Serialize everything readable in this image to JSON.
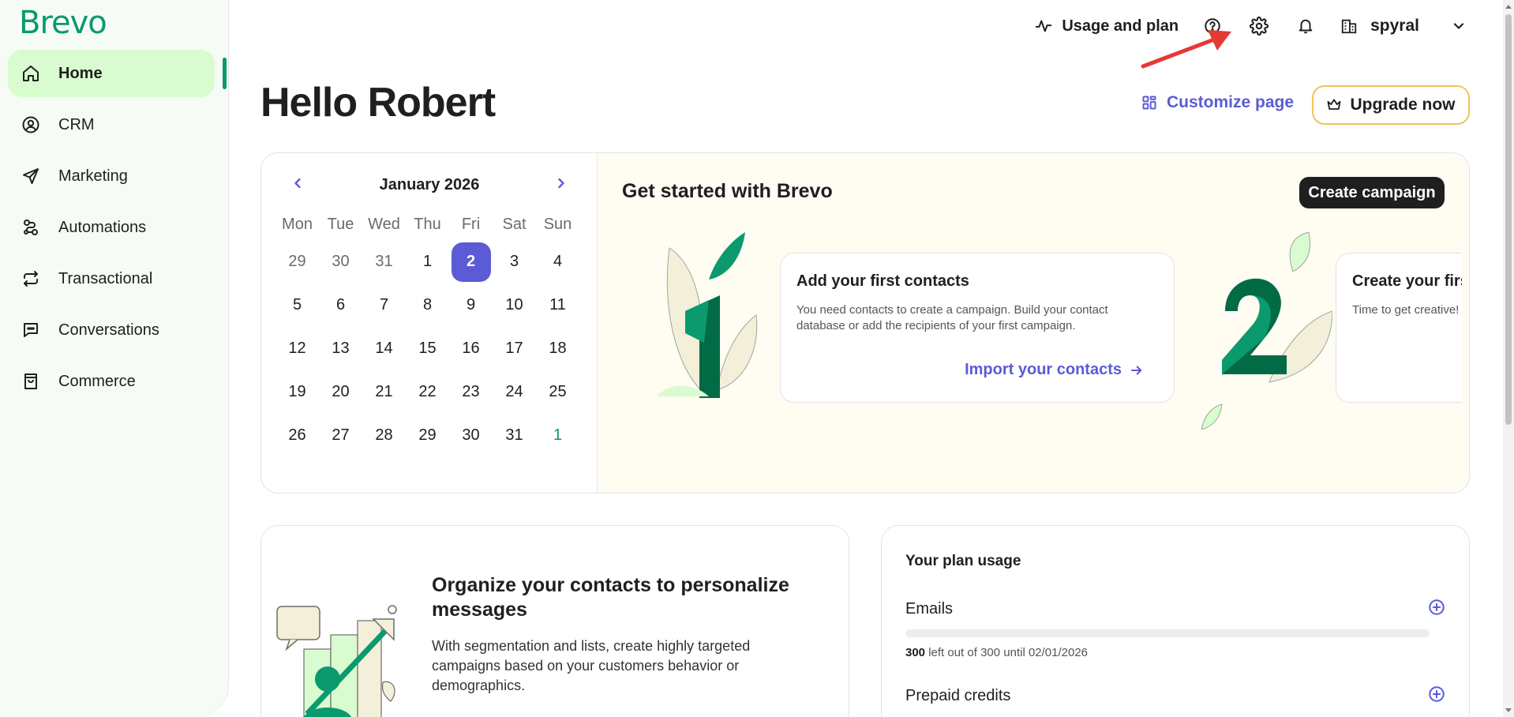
{
  "brand": {
    "logo": "Brevo",
    "accent": "#0b996e",
    "primary": "#5b5bd6"
  },
  "sidebar": {
    "items": [
      {
        "label": "Home",
        "icon": "home-icon",
        "active": true
      },
      {
        "label": "CRM",
        "icon": "user-circle-icon"
      },
      {
        "label": "Marketing",
        "icon": "send-icon"
      },
      {
        "label": "Automations",
        "icon": "automation-icon"
      },
      {
        "label": "Transactional",
        "icon": "repeat-icon"
      },
      {
        "label": "Conversations",
        "icon": "chat-icon"
      },
      {
        "label": "Commerce",
        "icon": "shopping-bag-icon"
      }
    ]
  },
  "topbar": {
    "usage_label": "Usage and plan",
    "account_name": "spyral"
  },
  "page": {
    "greeting": "Hello Robert",
    "customize_label": "Customize page",
    "upgrade_label": "Upgrade now"
  },
  "calendar": {
    "month": "January 2026",
    "weekdays": [
      "Mon",
      "Tue",
      "Wed",
      "Thu",
      "Fri",
      "Sat",
      "Sun"
    ],
    "weeks": [
      [
        "29",
        "30",
        "31",
        "1",
        "2",
        "3",
        "4"
      ],
      [
        "5",
        "6",
        "7",
        "8",
        "9",
        "10",
        "11"
      ],
      [
        "12",
        "13",
        "14",
        "15",
        "16",
        "17",
        "18"
      ],
      [
        "19",
        "20",
        "21",
        "22",
        "23",
        "24",
        "25"
      ],
      [
        "26",
        "27",
        "28",
        "29",
        "30",
        "31",
        "1"
      ]
    ],
    "today": "2"
  },
  "get_started": {
    "title": "Get started with Brevo",
    "create_label": "Create campaign",
    "steps": [
      {
        "number": "1",
        "title": "Add your first contacts",
        "description": "You need contacts to create a campaign. Build your contact database or add the recipients of your first campaign.",
        "link": "Import your contacts"
      },
      {
        "number": "2",
        "title": "Create your first campaign",
        "description": "Time to get creative! Pick an email template."
      }
    ]
  },
  "organize": {
    "title": "Organize your contacts to personalize messages",
    "description": "With segmentation and lists, create highly targeted campaigns based on your customers behavior or demographics."
  },
  "plan_usage": {
    "title": "Your plan usage",
    "emails_label": "Emails",
    "emails_left": "300",
    "emails_rest": " left out of 300 until 02/01/2026",
    "emails_used_fraction": 0,
    "prepaid_label": "Prepaid credits"
  }
}
